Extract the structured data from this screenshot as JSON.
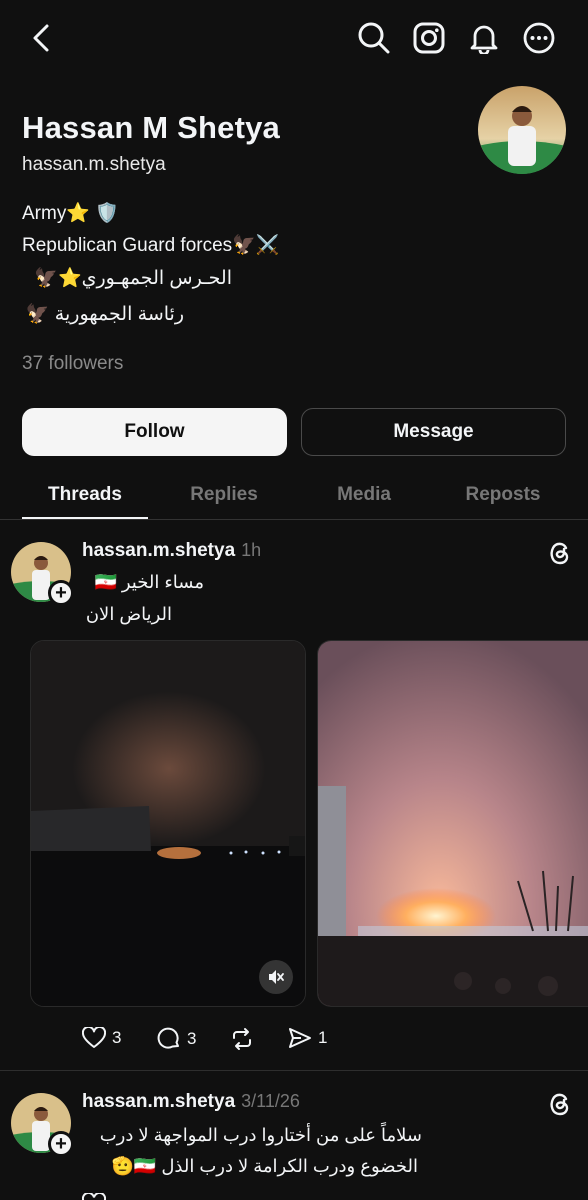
{
  "profile": {
    "name": "Hassan M Shetya",
    "handle": "hassan.m.shetya",
    "bio": [
      "Army⭐ 🛡️",
      "Republican Guard forces🦅⚔️",
      "الحـرس الجمهـوري⭐🦅",
      "رئاسة الجمهورية 🦅"
    ],
    "followers": "37 followers"
  },
  "buttons": {
    "follow": "Follow",
    "message": "Message"
  },
  "tabs": [
    "Threads",
    "Replies",
    "Media",
    "Reposts"
  ],
  "posts": [
    {
      "user": "hassan.m.shetya",
      "time": "1h",
      "lines": [
        "مساء الخير 🇮🇷",
        "الرياض الان"
      ],
      "likes": "3",
      "comments": "3",
      "shares": "1"
    },
    {
      "user": "hassan.m.shetya",
      "time": "3/11/26",
      "lines": [
        "سلاماً على من أختاروا درب المواجهة لا درب",
        "الخضوع ودرب الكرامة لا درب الذل 🇮🇷🫡"
      ]
    }
  ],
  "colors": {
    "background": "#101010",
    "accent": "#f5f5f5",
    "muted": "#777777"
  }
}
